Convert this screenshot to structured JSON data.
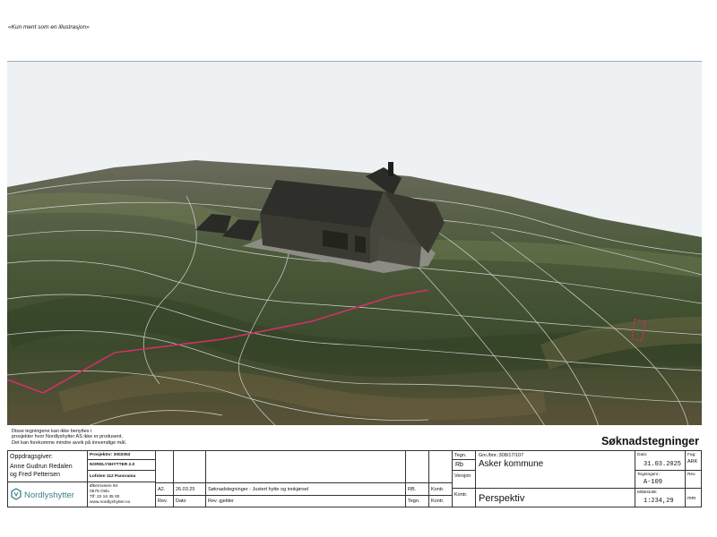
{
  "top_note": "«Kun ment som en illustrasjon»",
  "disclaimer": [
    "Disse tegningene kan ikke benyttes i",
    "prosjekter hvor Nordlyshytter AS ikke er produsent.",
    "Det kan forekomme mindre avvik på innvendige mål."
  ],
  "document_type": "Søknadstegninger",
  "client": {
    "label": "Oppdragsgiver:",
    "names": [
      "Anne Gudrun Redalen",
      "og Fred Pettersen"
    ]
  },
  "project": {
    "number": "Prosjektnr: 3002053",
    "model": "NORDLYSHYTTER 2.0",
    "variant": "Lofoten 112 Panorama"
  },
  "company": {
    "name": "Nordlyshytter",
    "address": [
      "Økernveien 94",
      "0579 Oslo",
      "Tlf: 22 16 35 00",
      "www.nordlyshytter.no"
    ]
  },
  "revision_table": {
    "rows": [
      {
        "rev": "A2.",
        "date": "26.03.25",
        "description": "Søknadstegninger - Justert hytte og innkjørsel",
        "drawn": "RB.",
        "checked": "Kontr."
      }
    ],
    "headers": {
      "rev": "Rev.",
      "date": "Dato",
      "description": "Rev. gjelder",
      "drawn": "Tegn.",
      "checked": "Kontr."
    }
  },
  "labels": {
    "drawn": "Tegn.",
    "version": "Versjon",
    "control": "Kontr.",
    "date": "Dato:",
    "discipline": "Fag:",
    "drawing_no": "Tegningsnr.:",
    "rev": "Rev.",
    "scale": "Målestokk",
    "unit": "mm"
  },
  "values": {
    "drawn_by": "Rb",
    "property": "Gnr./bnr.:308/17/107",
    "municipality": "Asker kommune",
    "drawing_title": "Perspektiv",
    "date": "31.03.2025",
    "discipline": "ARK",
    "drawing_no": "A-109",
    "scale": "1:234,29"
  }
}
